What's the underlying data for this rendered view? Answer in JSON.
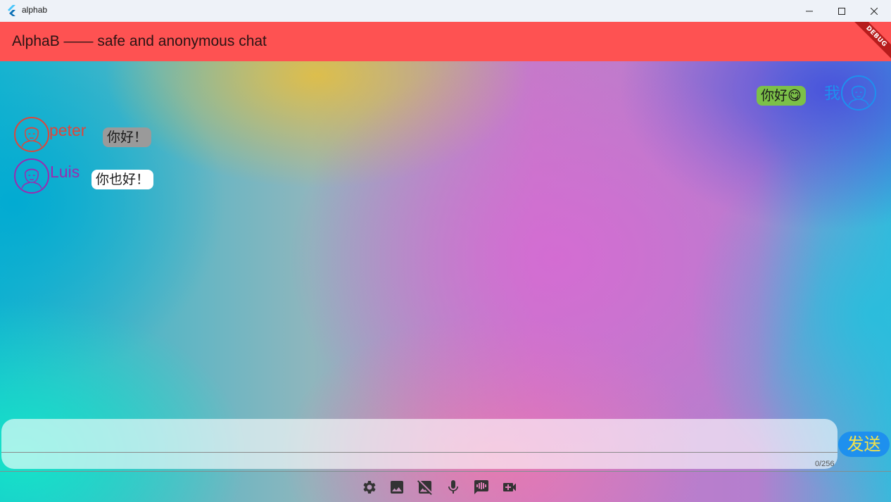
{
  "window": {
    "title": "alphab",
    "controls": [
      "minimize-icon",
      "maximize-icon",
      "close-icon"
    ]
  },
  "appbar": {
    "title": "AlphaB —— safe and anonymous chat",
    "color": "#fe5252",
    "debug_banner": "DEBUG"
  },
  "messages": [
    {
      "sender": "我",
      "text": "你好😋",
      "side": "right",
      "name_color": "#1e90ee",
      "bubble_color": "#7cc048"
    },
    {
      "sender": "peter",
      "text": "你好！",
      "side": "left",
      "name_color": "#e0453a",
      "bubble_color": "#9a9a9a"
    },
    {
      "sender": "Luis",
      "text": "你也好！",
      "side": "left",
      "name_color": "#9a2bb0",
      "bubble_color": "#ffffff"
    }
  ],
  "composer": {
    "value": "",
    "counter": "0/256",
    "send_label": "发送"
  },
  "toolbar": {
    "icons": [
      "settings-icon",
      "image-icon",
      "hide-image-icon",
      "microphone-icon",
      "voice-message-icon",
      "video-call-icon"
    ]
  }
}
